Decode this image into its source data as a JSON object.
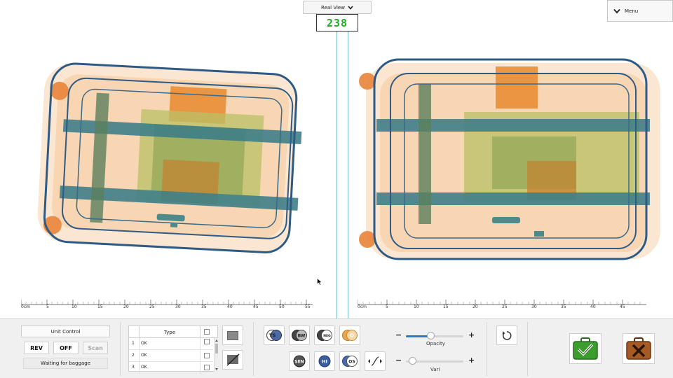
{
  "header": {
    "view_mode": "Real View",
    "bag_counter": "238",
    "menu_label": "Menu"
  },
  "rulers": {
    "left": [
      "0cm",
      "5",
      "10",
      "15",
      "20",
      "25",
      "30",
      "35",
      "40",
      "45",
      "50",
      "55"
    ],
    "right": [
      "0cm",
      "5",
      "10",
      "15",
      "20",
      "25",
      "30",
      "35",
      "40",
      "45"
    ]
  },
  "unit_control": {
    "title": "Unit Control",
    "rev_label": "REV",
    "off_label": "OFF",
    "scan_label": "Scan",
    "status": "Waiting for baggage"
  },
  "detection_table": {
    "header": "Type",
    "rows": [
      {
        "num": "1",
        "value": "OK"
      },
      {
        "num": "2",
        "value": "OK"
      },
      {
        "num": "3",
        "value": "OK"
      }
    ]
  },
  "image_tools": {
    "row1": [
      {
        "icon": "ts-icon",
        "text": "TS"
      },
      {
        "icon": "bw-icon",
        "text": "BW"
      },
      {
        "icon": "neg-icon",
        "text": "NEG"
      },
      {
        "icon": "organic-icon",
        "text": "O"
      }
    ],
    "row2": [
      {
        "icon": "sen-icon",
        "text": "SEN"
      },
      {
        "icon": "hi-icon",
        "text": "HI"
      },
      {
        "icon": "os-icon",
        "text": "OS"
      },
      {
        "icon": "gamma-curve-icon",
        "text": ""
      }
    ]
  },
  "sliders": {
    "opacity_label": "Opacity",
    "opacity_value": 0.42,
    "vari_label": "Vari",
    "vari_value": 0.05,
    "minus": "−",
    "plus": "+"
  },
  "colors": {
    "accept": "#3c9d2f",
    "reject": "#8c4a1e",
    "slider_fill": "#2f76c8",
    "counter_text": "#22aa22"
  }
}
